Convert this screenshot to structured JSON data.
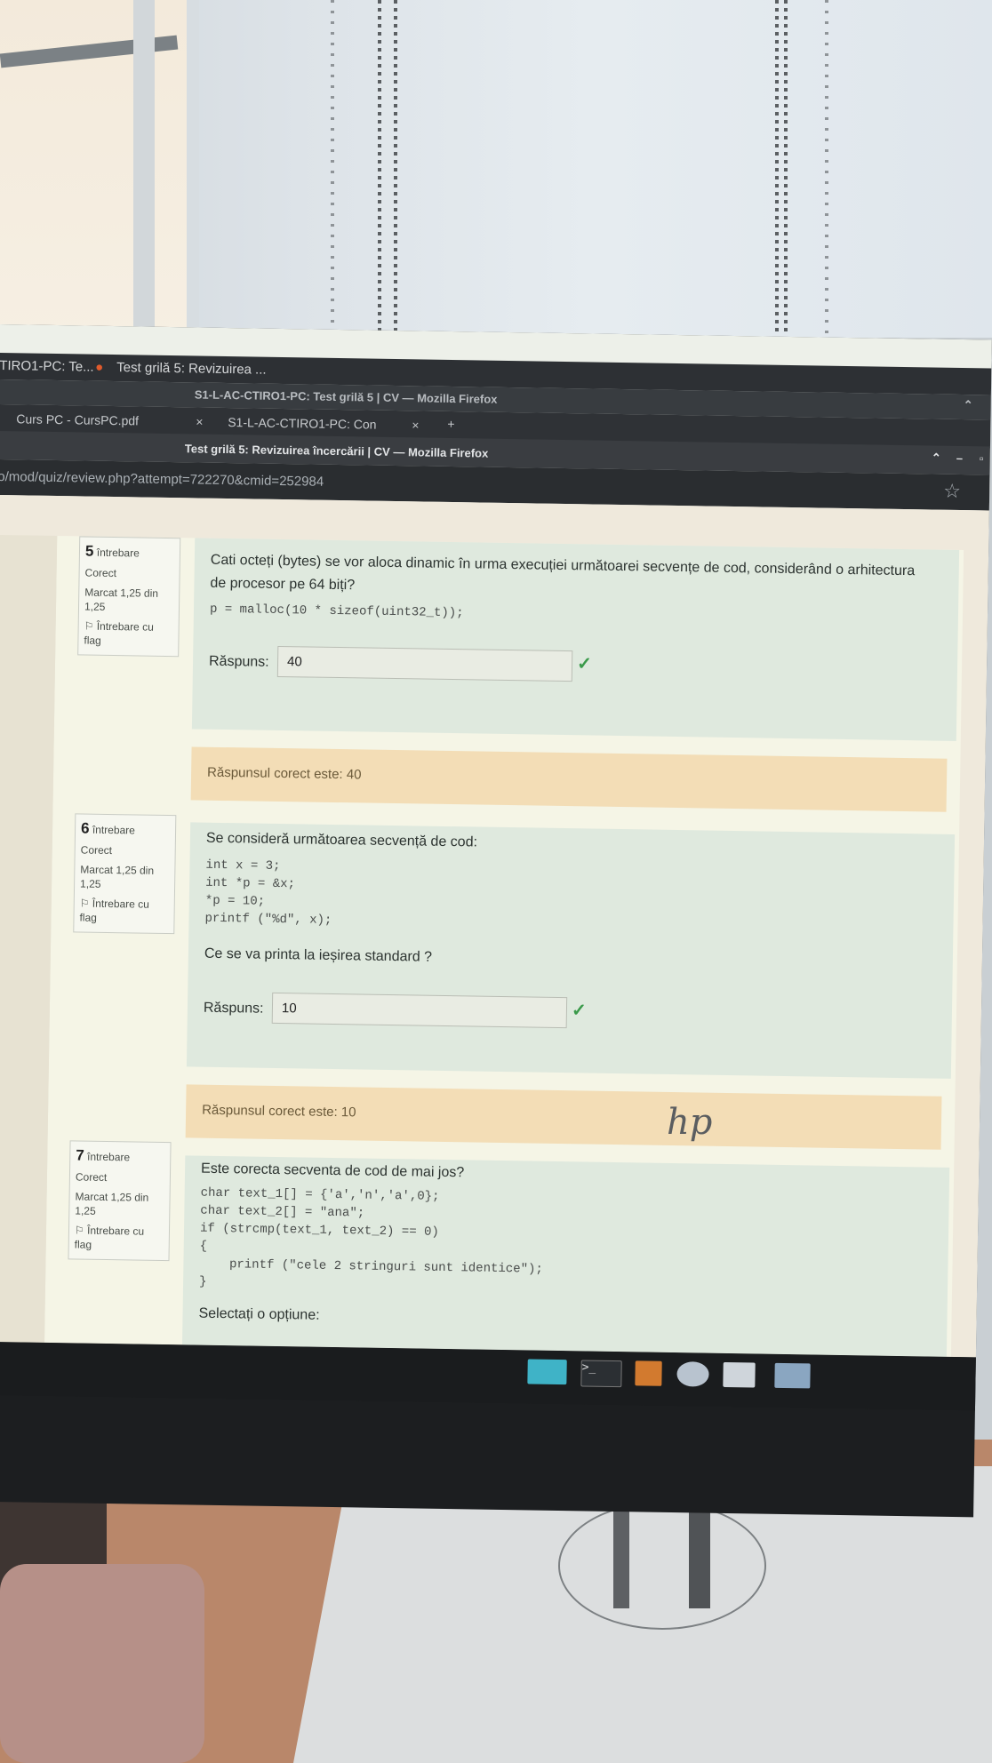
{
  "browser": {
    "tab_back_1": "TIRO1-PC: Te...",
    "tab_back_2": "Test grilă 5: Revizuirea ...",
    "window_title_back": "S1-L-AC-CTIRO1-PC: Test grilă 5 | CV — Mozilla Firefox",
    "tab_front_1": "Curs PC - CursPC.pdf",
    "tab_front_2": "S1-L-AC-CTIRO1-PC: Con",
    "tab_close": "×",
    "tab_new": "+",
    "window_title": "Test grilă 5: Revizuirea încercării | CV — Mozilla Firefox",
    "url": "o/mod/quiz/review.php?attempt=722270&cmid=252984",
    "bookmark_icon": "☆"
  },
  "questions": [
    {
      "number": "5",
      "label": "întrebare",
      "state": "Corect",
      "mark": "Marcat 1,25 din 1,25",
      "flag": "Întrebare cu flag",
      "text": "Cati octeți (bytes) se vor aloca dinamic în urma execuției următoarei secvențe de cod, considerând o arhitectura de procesor pe 64 biți?",
      "code": "p = malloc(10 * sizeof(uint32_t));",
      "answer_label": "Răspuns:",
      "answer": "40",
      "feedback": "Răspunsul corect este: 40"
    },
    {
      "number": "6",
      "label": "întrebare",
      "state": "Corect",
      "mark": "Marcat 1,25 din 1,25",
      "flag": "Întrebare cu flag",
      "text": "Se consideră următoarea secvență de cod:",
      "code": "int x = 3;\nint *p = &x;\n*p = 10;\nprintf (\"%d\", x);",
      "text2": "Ce se va printa la ieșirea standard ?",
      "answer_label": "Răspuns:",
      "answer": "10",
      "feedback": "Răspunsul corect este: 10"
    },
    {
      "number": "7",
      "label": "întrebare",
      "state": "Corect",
      "mark": "Marcat 1,25 din 1,25",
      "flag": "Întrebare cu flag",
      "text": "Este corecta secventa de cod de mai jos?",
      "code": "char text_1[] = {'a','n','a',0};\nchar text_2[] = \"ana\";\nif (strcmp(text_1, text_2) == 0)\n{\n    printf (\"cele 2 stringuri sunt identice\");\n}",
      "text2": "Selectați o opțiune:"
    }
  ],
  "monitor_logo": "hp",
  "colors": {
    "correct_bg": "#dfe9de",
    "feedback_bg": "#f3ddb6",
    "check": "#3a9a4a"
  }
}
